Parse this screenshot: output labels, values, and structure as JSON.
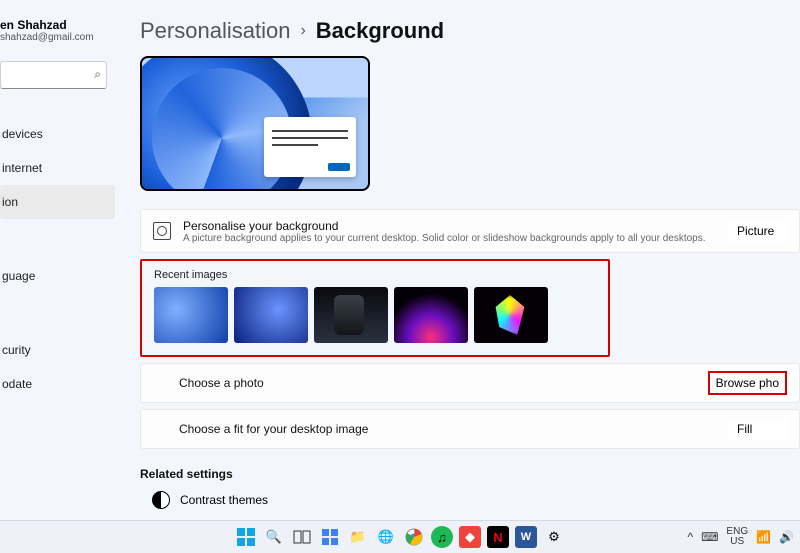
{
  "user": {
    "name": "en Shahzad",
    "email": "shahzad@gmail.com"
  },
  "search": {
    "placeholder": ""
  },
  "nav": {
    "devices": "devices",
    "internet": "internet",
    "ion": "ion",
    "guage": "guage",
    "curity": "curity",
    "odate": "odate"
  },
  "breadcrumb": {
    "parent": "Personalisation",
    "sep": "›",
    "current": "Background"
  },
  "personalise": {
    "title": "Personalise your background",
    "sub": "A picture background applies to your current desktop. Solid color or slideshow backgrounds apply to all your desktops.",
    "value": "Picture"
  },
  "recent": {
    "title": "Recent images"
  },
  "choose_photo": {
    "label": "Choose a photo",
    "button": "Browse pho"
  },
  "choose_fit": {
    "label": "Choose a fit for your desktop image",
    "value": "Fill"
  },
  "related": {
    "title": "Related settings",
    "contrast": "Contrast themes"
  },
  "taskbar": {
    "lang": "ENG",
    "region": "US",
    "chevron": "^"
  }
}
